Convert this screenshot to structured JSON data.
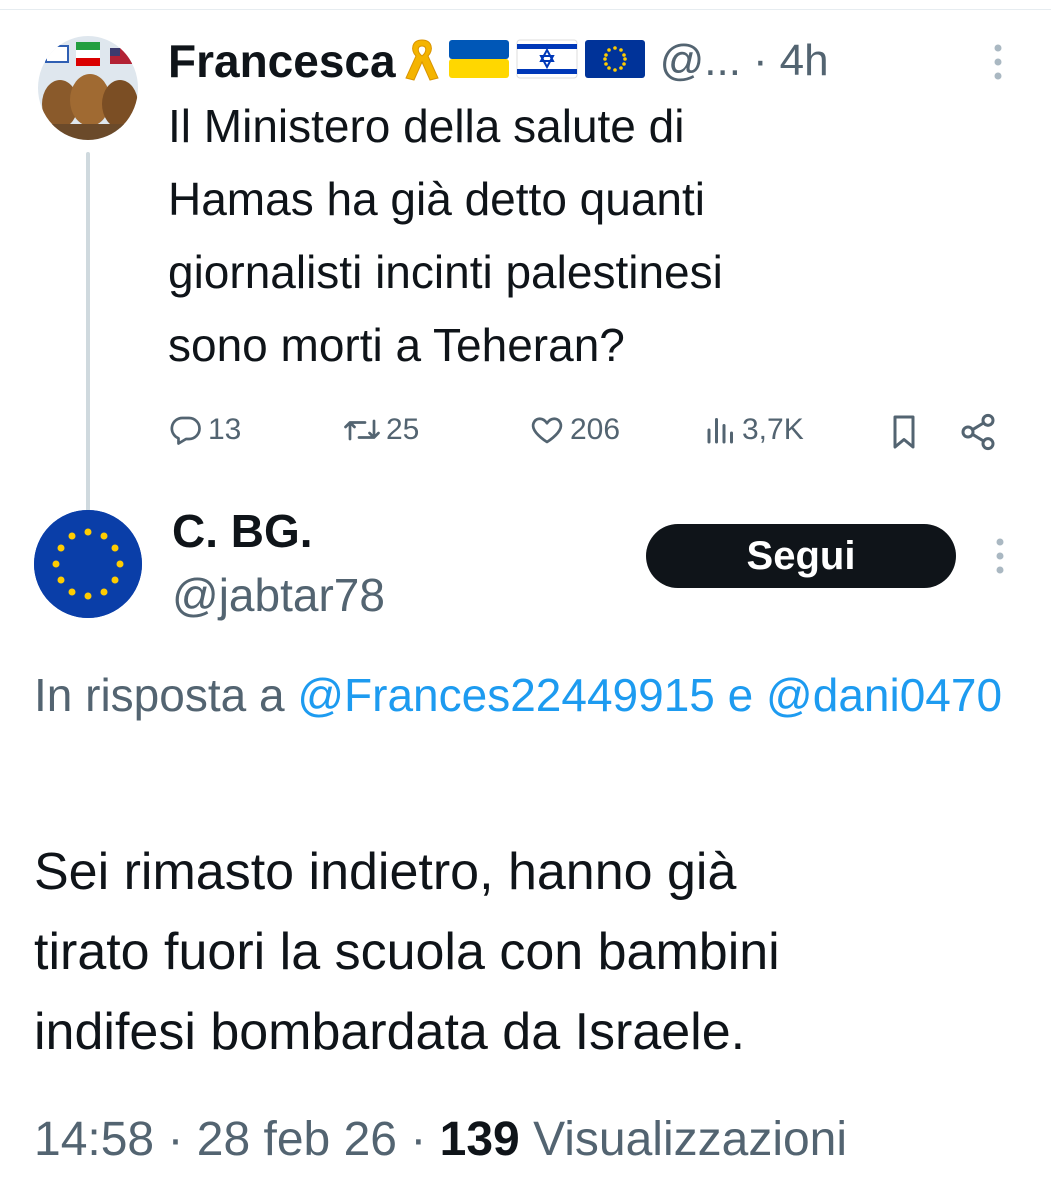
{
  "parent_tweet": {
    "author_name": "Francesca",
    "author_flags": [
      "yellow-ribbon-emoji",
      "ukraine-flag-emoji",
      "israel-flag-emoji",
      "eu-flag-emoji"
    ],
    "handle": "@...",
    "separator": "·",
    "time": "4h",
    "text": "Il Ministero della salute di\nHamas ha già detto quanti\ngiornalisti incinti palestinesi\nsono morti a Teheran?",
    "replies": "13",
    "reposts": "25",
    "likes": "206",
    "views": "3,7K"
  },
  "reply_tweet": {
    "author_name": "C. BG.",
    "handle": "@jabtar78",
    "follow_label": "Segui",
    "reply_prefix": "In risposta a",
    "mention1": "@Frances22449915",
    "conj": "e",
    "mention2": "@dani0470",
    "text": "Sei rimasto indietro, hanno già\ntirato fuori la scuola con bambini\nindifesi bombardata da Israele.",
    "time": "14:58",
    "date": "28 feb 26",
    "sep": "·",
    "views_count": "139",
    "views_label": "Visualizzazioni"
  },
  "colors": {
    "text": "#0f1419",
    "secondary": "#536471",
    "link": "#1d9bf0",
    "follow_bg": "#0f1419",
    "eu_blue": "#0a3ea8",
    "eu_star": "#ffcc00"
  }
}
